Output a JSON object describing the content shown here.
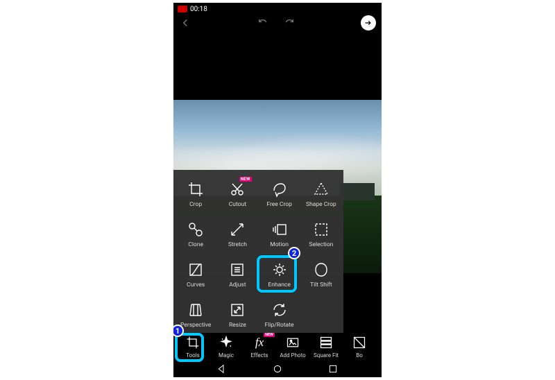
{
  "status": {
    "time": "00:18"
  },
  "tools_popup": {
    "crop": "Crop",
    "cutout": "Cutout",
    "cutout_badge": "NEW",
    "free_crop": "Free Crop",
    "shape_crop": "Shape Crop",
    "clone": "Clone",
    "stretch": "Stretch",
    "motion": "Motion",
    "selection": "Selection",
    "curves": "Curves",
    "adjust": "Adjust",
    "enhance": "Enhance",
    "tilt_shift": "Tilt Shift",
    "perspective": "Perspective",
    "resize": "Resize",
    "flip_rotate": "Flip/Rotate"
  },
  "toolbar": {
    "tools": "Tools",
    "magic": "Magic",
    "effects": "Effects",
    "effects_badge": "NEW",
    "add_photo": "Add Photo",
    "square_fit": "Square Fit",
    "border": "Bo"
  },
  "steps": {
    "one": "1",
    "two": "2"
  }
}
